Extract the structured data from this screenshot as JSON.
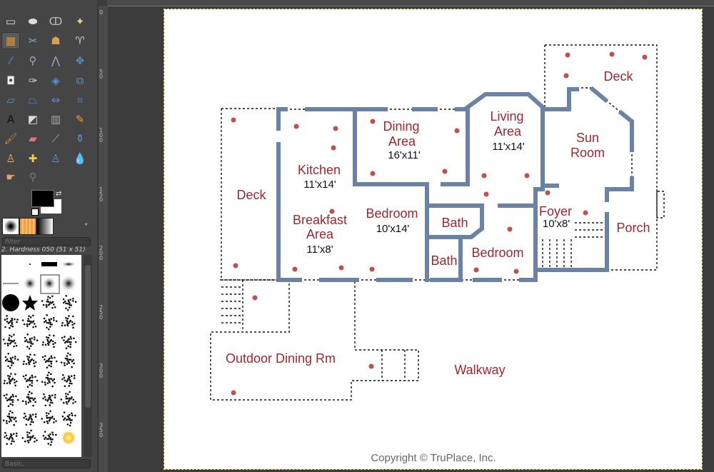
{
  "toolbox": {
    "tools": [
      {
        "icon": "rect-select-icon",
        "glyph": "▭",
        "color": "#ddd"
      },
      {
        "icon": "ellipse-select-icon",
        "glyph": "⬬",
        "color": "#ddd"
      },
      {
        "icon": "free-select-icon",
        "glyph": "ↀ",
        "color": "#bbb"
      },
      {
        "icon": "fuzzy-select-icon",
        "glyph": "✦",
        "color": "#e8d070"
      },
      {
        "icon": "select-by-color-icon",
        "glyph": "▦",
        "color": "#e89030"
      },
      {
        "icon": "scissors-select-icon",
        "glyph": "✂",
        "color": "#8ab"
      },
      {
        "icon": "foreground-select-icon",
        "glyph": "☗",
        "color": "#d9a050"
      },
      {
        "icon": "paths-icon",
        "glyph": "♈",
        "color": "#ccc"
      },
      {
        "icon": "color-picker-icon",
        "glyph": "⁄",
        "color": "#5a8fd0"
      },
      {
        "icon": "zoom-icon",
        "glyph": "⚲",
        "color": "#9ab"
      },
      {
        "icon": "measure-icon",
        "glyph": "⋀",
        "color": "#9ab"
      },
      {
        "icon": "move-icon",
        "glyph": "✥",
        "color": "#5a8fd0"
      },
      {
        "icon": "align-icon",
        "glyph": "◘",
        "color": "#eee"
      },
      {
        "icon": "crop-icon",
        "glyph": "✑",
        "color": "#ddd"
      },
      {
        "icon": "rotate-icon",
        "glyph": "◈",
        "color": "#5a8fd0"
      },
      {
        "icon": "scale-icon",
        "glyph": "⧉",
        "color": "#5a8fd0"
      },
      {
        "icon": "shear-icon",
        "glyph": "▱",
        "color": "#5a8fd0"
      },
      {
        "icon": "perspective-icon",
        "glyph": "⏢",
        "color": "#5a8fd0"
      },
      {
        "icon": "flip-icon",
        "glyph": "⇔",
        "color": "#5a8fd0"
      },
      {
        "icon": "cage-transform-icon",
        "glyph": "⌗",
        "color": "#5a8fd0"
      },
      {
        "icon": "text-icon",
        "glyph": "A",
        "color": "#111"
      },
      {
        "icon": "bucket-fill-icon",
        "glyph": "◩",
        "color": "#ddd"
      },
      {
        "icon": "blend-icon",
        "glyph": "▥",
        "color": "#aaa"
      },
      {
        "icon": "pencil-icon",
        "glyph": "✎",
        "color": "#e8a030"
      },
      {
        "icon": "paintbrush-icon",
        "glyph": "🖌",
        "color": "#d08040"
      },
      {
        "icon": "eraser-icon",
        "glyph": "▰",
        "color": "#e07878"
      },
      {
        "icon": "airbrush-icon",
        "glyph": "⟋",
        "color": "#9ab"
      },
      {
        "icon": "ink-icon",
        "glyph": "⚱",
        "color": "#5a8fd0"
      },
      {
        "icon": "clone-icon",
        "glyph": "♙",
        "color": "#e8b050"
      },
      {
        "icon": "heal-icon",
        "glyph": "✚",
        "color": "#e8d040"
      },
      {
        "icon": "perspective-clone-icon",
        "glyph": "♙",
        "color": "#5a8fd0"
      },
      {
        "icon": "blur-icon",
        "glyph": "💧",
        "color": "#5a8fd0"
      },
      {
        "icon": "smudge-icon",
        "glyph": "☛",
        "color": "#e0a070"
      },
      {
        "icon": "dodge-burn-icon",
        "glyph": "⚲",
        "color": "#777"
      }
    ],
    "fg_color": "#000000",
    "bg_color": "#ffffff",
    "filter_placeholder": "filter",
    "brush_name": "2. Hardness 050 (51 x 51)",
    "brush_tag": "Basic,"
  },
  "ruler": {
    "vertical_labels": [
      "0",
      "50",
      "100",
      "150",
      "200",
      "250",
      "300",
      "350"
    ]
  },
  "plan": {
    "colors": {
      "wall": "#6a82a4",
      "label": "#a1272c",
      "fixture": "#c0504d"
    },
    "rooms": [
      {
        "name": "Deck"
      },
      {
        "name": "Kitchen",
        "dim": "11'x14'"
      },
      {
        "name": "Breakfast",
        "name2": "Area",
        "dim": "11'x8'"
      },
      {
        "name": "Dining",
        "name2": "Area",
        "dim": "16'x11'"
      },
      {
        "name": "Living",
        "name2": "Area",
        "dim": "11'x14'"
      },
      {
        "name": "Deck"
      },
      {
        "name": "Sun",
        "name2": "Room"
      },
      {
        "name": "Bedroom",
        "dim": "10'x14'"
      },
      {
        "name": "Bath"
      },
      {
        "name": "Bath"
      },
      {
        "name": "Bedroom"
      },
      {
        "name": "Foyer",
        "dim": "10'x8'"
      },
      {
        "name": "Porch"
      },
      {
        "name": "Outdoor Dining Rm"
      },
      {
        "name": "Walkway"
      }
    ],
    "copyright": "Copyright © TruPlace, Inc."
  }
}
